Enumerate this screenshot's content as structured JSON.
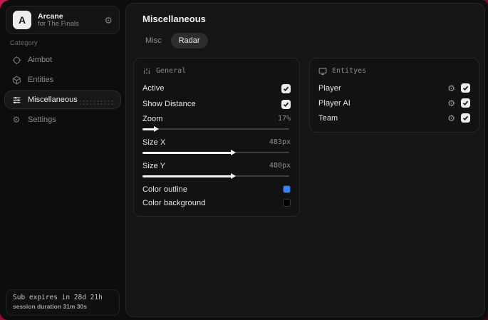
{
  "brand": {
    "initial": "A",
    "name": "Arcane",
    "subtitle": "for The Finals"
  },
  "sidebar": {
    "category_label": "Category",
    "items": [
      {
        "label": "Aimbot",
        "active": false
      },
      {
        "label": "Entities",
        "active": false
      },
      {
        "label": "Miscellaneous",
        "active": true
      },
      {
        "label": "Settings",
        "active": false
      }
    ],
    "status": {
      "line1": "Sub expires in 28d 21h",
      "line2": "session duration 31m 30s"
    }
  },
  "main": {
    "title": "Miscellaneous",
    "tabs": [
      {
        "label": "Misc",
        "active": false
      },
      {
        "label": "Radar",
        "active": true
      }
    ],
    "general_card": {
      "title": "General",
      "toggles": [
        {
          "label": "Active",
          "checked": true
        },
        {
          "label": "Show Distance",
          "checked": true
        }
      ],
      "sliders": [
        {
          "label": "Zoom",
          "value": "17%",
          "fill_pct": 8
        },
        {
          "label": "Size X",
          "value": "483px",
          "fill_pct": 60
        },
        {
          "label": "Size Y",
          "value": "480px",
          "fill_pct": 60
        }
      ],
      "colors": [
        {
          "label": "Color outline",
          "swatch": "#3b82f6"
        },
        {
          "label": "Color background",
          "swatch": "#000000"
        }
      ]
    },
    "entities_card": {
      "title": "Entityes",
      "rows": [
        {
          "label": "Player",
          "checked": true
        },
        {
          "label": "Player AI",
          "checked": true
        },
        {
          "label": "Team",
          "checked": true
        }
      ]
    }
  },
  "colors": {
    "accent_red": "#b61740",
    "panel_bg": "#151515",
    "card_bg": "#121212"
  }
}
